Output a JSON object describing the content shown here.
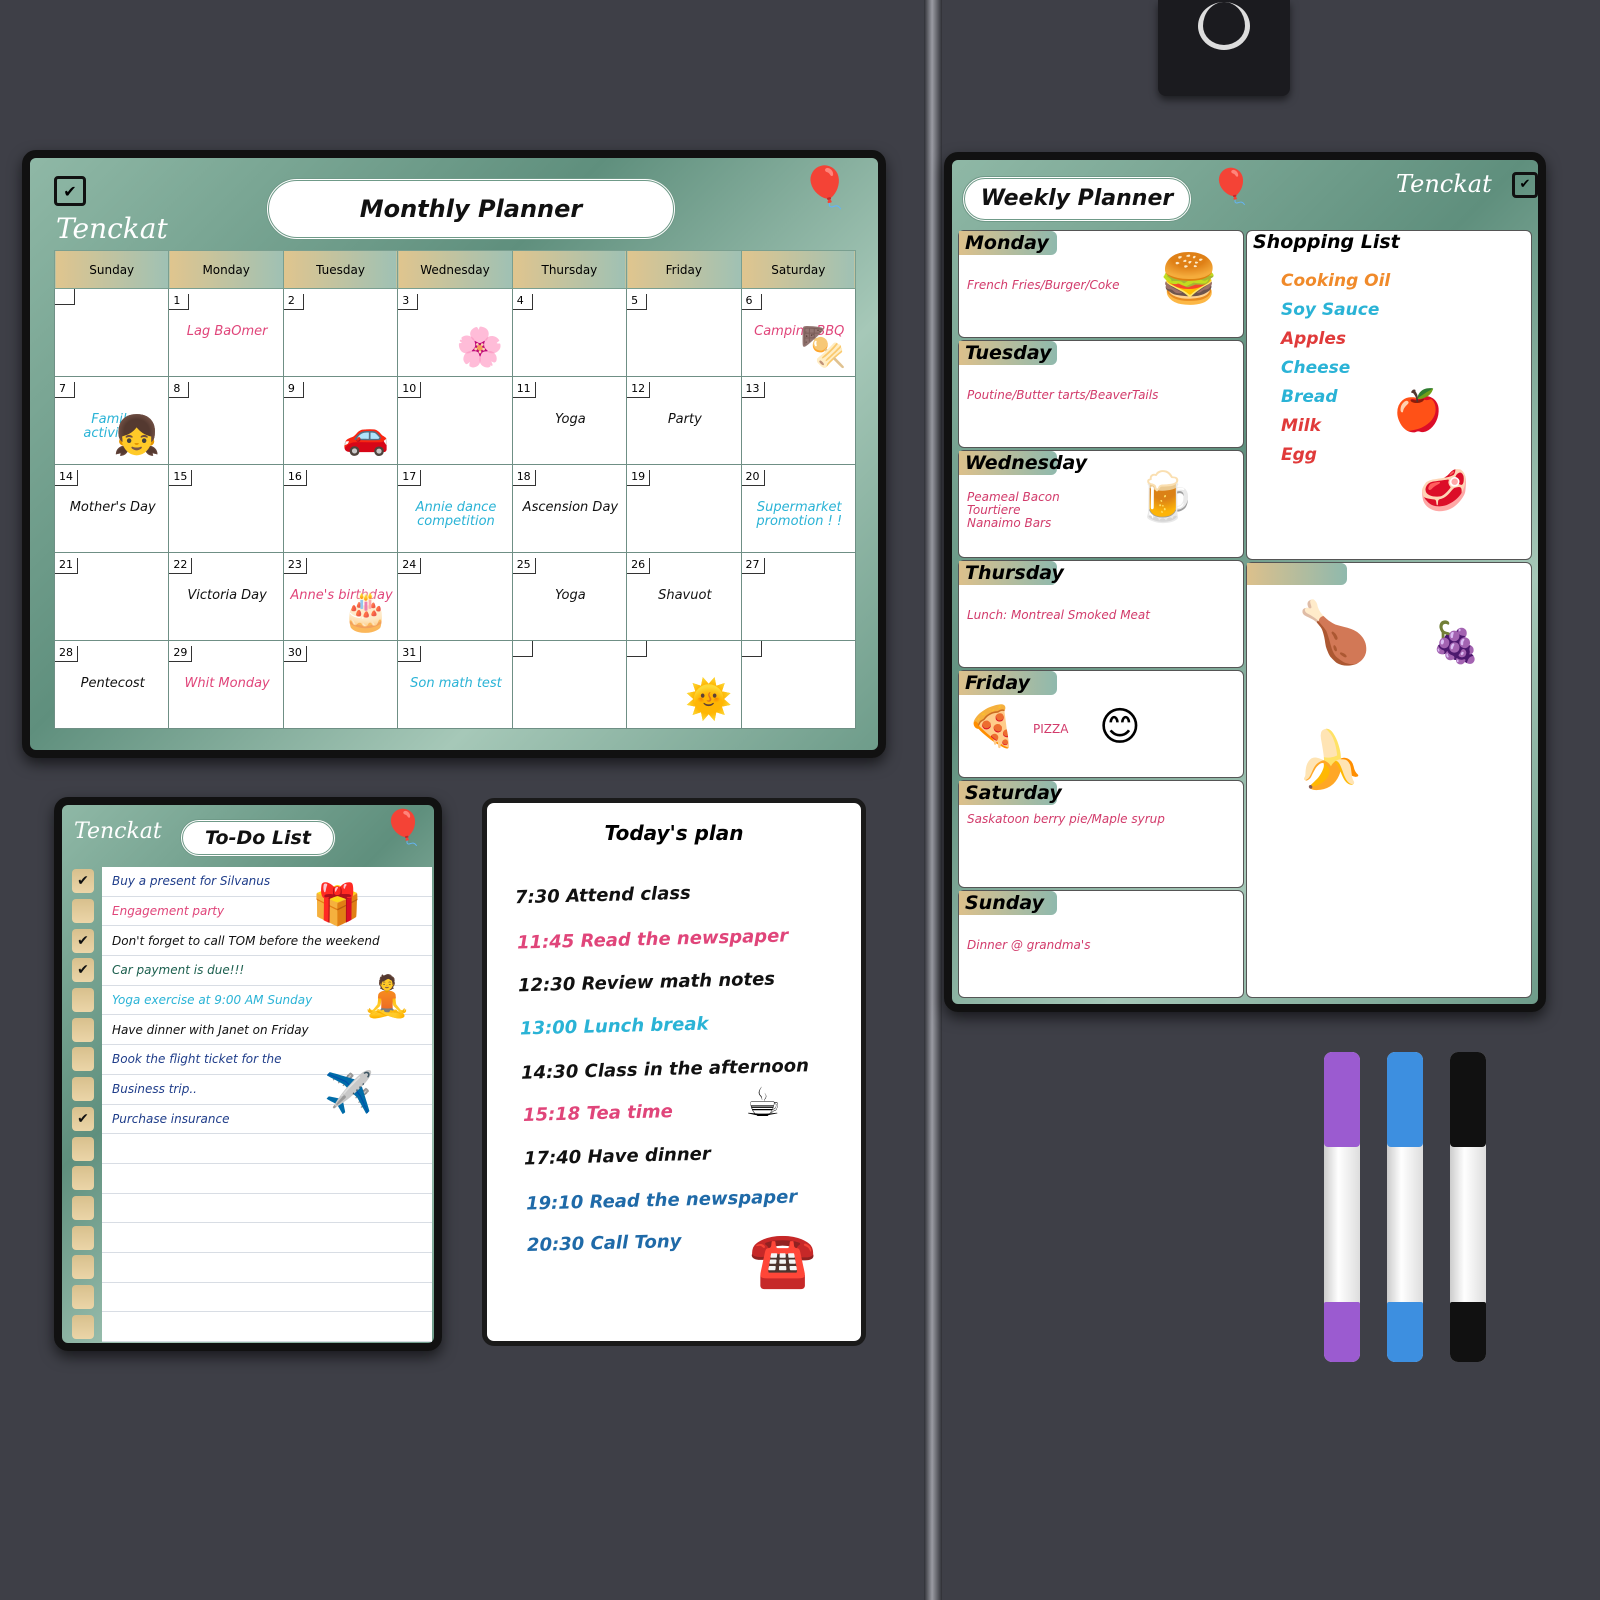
{
  "monthly": {
    "title": "Monthly Planner",
    "brand": "Tenckat",
    "days": [
      "Sunday",
      "Monday",
      "Tuesday",
      "Wednesday",
      "Thursday",
      "Friday",
      "Saturday"
    ],
    "weeks": [
      [
        [
          "",
          ""
        ],
        [
          "1",
          "Lag BaOmer"
        ],
        [
          "2",
          ""
        ],
        [
          "3",
          ""
        ],
        [
          "4",
          ""
        ],
        [
          "5",
          ""
        ],
        [
          "6",
          "Camping BBQ"
        ]
      ],
      [
        [
          "7",
          "Family activities"
        ],
        [
          "8",
          ""
        ],
        [
          "9",
          ""
        ],
        [
          "10",
          ""
        ],
        [
          "11",
          "Yoga"
        ],
        [
          "12",
          "Party"
        ],
        [
          "13",
          ""
        ]
      ],
      [
        [
          "14",
          "Mother's Day"
        ],
        [
          "15",
          ""
        ],
        [
          "16",
          ""
        ],
        [
          "17",
          "Annie dance competition"
        ],
        [
          "18",
          "Ascension Day"
        ],
        [
          "19",
          ""
        ],
        [
          "20",
          "Supermarket promotion ! !"
        ]
      ],
      [
        [
          "21",
          ""
        ],
        [
          "22",
          "Victoria Day"
        ],
        [
          "23",
          "Anne's birthday"
        ],
        [
          "24",
          ""
        ],
        [
          "25",
          "Yoga"
        ],
        [
          "26",
          "Shavuot"
        ],
        [
          "27",
          ""
        ]
      ],
      [
        [
          "28",
          "Pentecost"
        ],
        [
          "29",
          "Whit Monday"
        ],
        [
          "30",
          ""
        ],
        [
          "31",
          "Son math test"
        ],
        [
          "",
          ""
        ],
        [
          "",
          ""
        ],
        [
          "",
          ""
        ]
      ]
    ],
    "text_colors": {
      "Lag BaOmer": "#e0457a",
      "Camping BBQ": "#e0457a",
      "Family activities": "#2ab3d6",
      "Annie dance competition": "#2ab3d6",
      "Supermarket promotion ! !": "#2ab3d6",
      "Anne's birthday": "#e0457a",
      "Whit Monday": "#e0457a",
      "Son math test": "#2ab3d6"
    }
  },
  "todo": {
    "title": "To-Do List",
    "brand": "Tenckat",
    "items": [
      {
        "text": "Buy a present for Silvanus",
        "checked": true,
        "color": "#1f3d8a"
      },
      {
        "text": "Engagement party",
        "checked": false,
        "color": "#e0457a"
      },
      {
        "text": "Don't forget to call TOM before the weekend",
        "checked": true,
        "color": "#111111"
      },
      {
        "text": "Car payment is due!!!",
        "checked": true,
        "color": "#1c5f4e"
      },
      {
        "text": "Yoga exercise at 9:00 AM Sunday",
        "checked": false,
        "color": "#2ab3d6"
      },
      {
        "text": "Have dinner with Janet on Friday",
        "checked": false,
        "color": "#111111"
      },
      {
        "text": "Book the flight ticket for the",
        "checked": false,
        "color": "#1f3d8a"
      },
      {
        "text": "Business trip..",
        "checked": false,
        "color": "#1f3d8a"
      },
      {
        "text": "Purchase insurance",
        "checked": true,
        "color": "#1f3d8a"
      },
      {
        "text": "",
        "checked": false
      },
      {
        "text": "",
        "checked": false
      },
      {
        "text": "",
        "checked": false
      },
      {
        "text": "",
        "checked": false
      },
      {
        "text": "",
        "checked": false
      },
      {
        "text": "",
        "checked": false
      },
      {
        "text": "",
        "checked": false
      }
    ]
  },
  "today": {
    "title": "Today's plan",
    "items": [
      {
        "text": "7:30 Attend class",
        "color": "#111111"
      },
      {
        "text": "11:45 Read the newspaper",
        "color": "#e0457a"
      },
      {
        "text": "12:30 Review math notes",
        "color": "#111111"
      },
      {
        "text": "13:00 Lunch break",
        "color": "#2ab3d6"
      },
      {
        "text": "14:30 Class in the afternoon",
        "color": "#111111"
      },
      {
        "text": "15:18 Tea time",
        "color": "#e0457a"
      },
      {
        "text": "17:40 Have dinner",
        "color": "#111111"
      },
      {
        "text": "19:10 Read the newspaper",
        "color": "#1f6aa8"
      },
      {
        "text": "20:30 Call Tony",
        "color": "#1f6aa8"
      }
    ]
  },
  "weekly": {
    "title": "Weekly Planner",
    "brand": "Tenckat",
    "days": [
      {
        "label": "Monday",
        "lines": [
          "French Fries/Burger/Coke"
        ]
      },
      {
        "label": "Tuesday",
        "lines": [
          "Poutine/Butter tarts/BeaverTails"
        ]
      },
      {
        "label": "Wednesday",
        "lines": [
          "Peameal Bacon",
          "Tourtiere",
          "Nanaimo Bars"
        ]
      },
      {
        "label": "Thursday",
        "lines": [
          "Lunch: Montreal Smoked Meat"
        ]
      },
      {
        "label": "Friday",
        "lines": [
          "PIZZA"
        ]
      },
      {
        "label": "Saturday",
        "lines": [
          "Saskatoon berry pie/Maple syrup"
        ]
      },
      {
        "label": "Sunday",
        "lines": [
          "Dinner @ grandma's"
        ]
      }
    ],
    "shopping": {
      "title": "Shopping List",
      "items": [
        {
          "text": "Cooking Oil",
          "color": "#f08a2a"
        },
        {
          "text": "Soy Sauce",
          "color": "#2ab3d6"
        },
        {
          "text": "Apples",
          "color": "#e03a3a"
        },
        {
          "text": "Cheese",
          "color": "#2ab3d6"
        },
        {
          "text": "Bread",
          "color": "#2ab3d6"
        },
        {
          "text": "Milk",
          "color": "#e03a3a"
        },
        {
          "text": "Egg",
          "color": "#e03a3a"
        }
      ]
    }
  },
  "markers": [
    {
      "color": "#9b5bd0"
    },
    {
      "color": "#3d8fe0"
    },
    {
      "color": "#111111"
    }
  ]
}
